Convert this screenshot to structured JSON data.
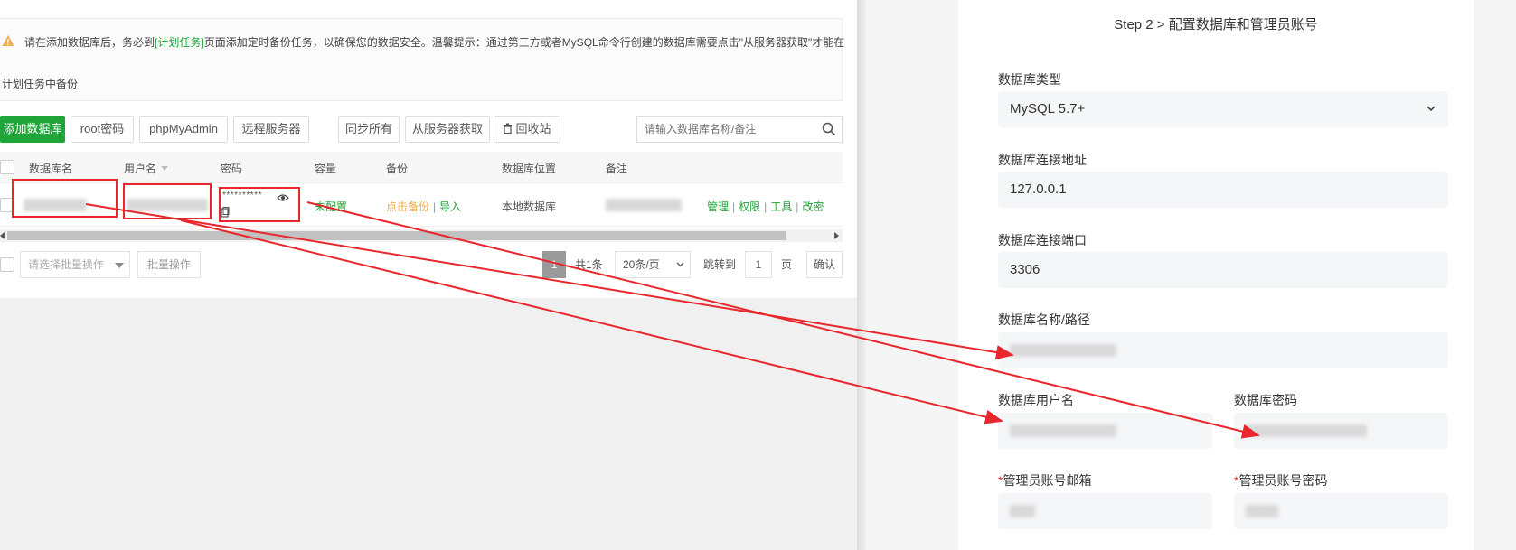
{
  "notice": {
    "line1_prefix": "请在添加数据库后，务必到",
    "line1_link": "[计划任务]",
    "line1_suffix": "页面添加定时备份任务，以确保您的数据安全。温馨提示：通过第三方或者MySQL命令行创建的数据库需要点击\"从服务器获取\"才能在",
    "line2": "计划任务中备份"
  },
  "toolbar": {
    "add_db": "添加数据库",
    "root_pwd": "root密码",
    "phpmyadmin": "phpMyAdmin",
    "remote": "远程服务器",
    "sync_all": "同步所有",
    "fetch": "从服务器获取",
    "recycle": "回收站",
    "search_placeholder": "请输入数据库名称/备注"
  },
  "table": {
    "headers": [
      "数据库名",
      "用户名",
      "密码",
      "容量",
      "备份",
      "数据库位置",
      "备注"
    ],
    "row": {
      "password_mask": "**********",
      "capacity": "未配置",
      "backup": "点击备份",
      "import": "导入",
      "location": "本地数据库",
      "actions": [
        "管理",
        "权限",
        "工具",
        "改密"
      ]
    }
  },
  "bottom": {
    "batch_placeholder": "请选择批量操作",
    "batch_btn": "批量操作",
    "page_current": "1",
    "total": "共1条",
    "per_page": "20条/页",
    "jump_to": "跳转到",
    "jump_value": "1",
    "page_unit": "页",
    "confirm": "确认"
  },
  "form": {
    "step_title": "Step 2 > 配置数据库和管理员账号",
    "db_type_label": "数据库类型",
    "db_type_value": "MySQL 5.7+",
    "db_host_label": "数据库连接地址",
    "db_host_value": "127.0.0.1",
    "db_port_label": "数据库连接端口",
    "db_port_value": "3306",
    "db_name_label": "数据库名称/路径",
    "db_user_label": "数据库用户名",
    "db_pwd_label": "数据库密码",
    "admin_email_label": "管理员账号邮箱",
    "admin_pwd_label": "管理员账号密码",
    "required_mark": "*"
  },
  "colors": {
    "accent_green": "#20a53a",
    "annotation_red": "#e8262b",
    "warning_orange": "#f0ad4e"
  }
}
